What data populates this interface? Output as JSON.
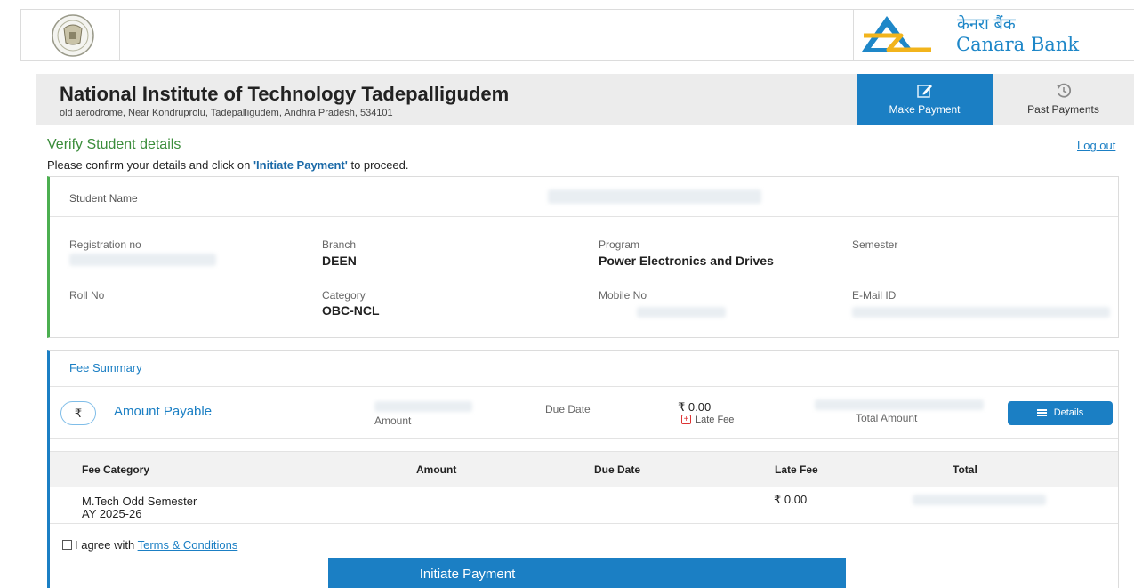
{
  "header": {
    "bank_name_hindi": "केनरा बैंक",
    "bank_name_english": "Canara Bank",
    "brand_color": "#1b7fc4"
  },
  "institute": {
    "name": "National Institute of Technology Tadepalligudem",
    "address": "old aerodrome, Near Kondruprolu, Tadepalligudem, Andhra Pradesh, 534101"
  },
  "nav": {
    "make_payment": {
      "label": "Make Payment",
      "icon": "edit-icon"
    },
    "past_payments": {
      "label": "Past Payments",
      "icon": "history-icon"
    }
  },
  "verify": {
    "title": "Verify Student details",
    "instruction_pre": "Please confirm your details and click on ",
    "instruction_bold": "'Initiate Payment'",
    "instruction_post": " to proceed.",
    "logout": "Log out"
  },
  "student": {
    "name_label": "Student Name",
    "fields": {
      "registration_no": {
        "label": "Registration no",
        "value": ""
      },
      "branch": {
        "label": "Branch",
        "value": "DEEN"
      },
      "program": {
        "label": "Program",
        "value": "Power Electronics and Drives"
      },
      "semester": {
        "label": "Semester",
        "value": ""
      },
      "roll_no": {
        "label": "Roll No",
        "value": ""
      },
      "category": {
        "label": "Category",
        "value": "OBC-NCL"
      },
      "mobile_no": {
        "label": "Mobile No",
        "value": ""
      },
      "email_id": {
        "label": "E-Mail ID",
        "value": ""
      }
    }
  },
  "fee_summary": {
    "title": "Fee Summary",
    "rupee_symbol": "₹",
    "amount_payable_label": "Amount Payable",
    "amount_label": "Amount",
    "due_date_label": "Due Date",
    "late_fee_value": "₹ 0.00",
    "late_fee_label": "Late Fee",
    "total_amount_label": "Total Amount",
    "details_button": "Details",
    "table": {
      "headers": [
        "Fee Category",
        "Amount",
        "Due Date",
        "Late Fee",
        "Total"
      ],
      "rows": [
        {
          "category_line1": "M.Tech Odd Semester",
          "category_line2": "AY 2025-26",
          "amount": "",
          "due_date": "",
          "late_fee": "₹ 0.00",
          "total": ""
        }
      ]
    }
  },
  "agreement": {
    "prefix": "I agree with ",
    "link": "Terms & Conditions",
    "checked": false
  },
  "actions": {
    "initiate_payment": "Initiate Payment"
  }
}
